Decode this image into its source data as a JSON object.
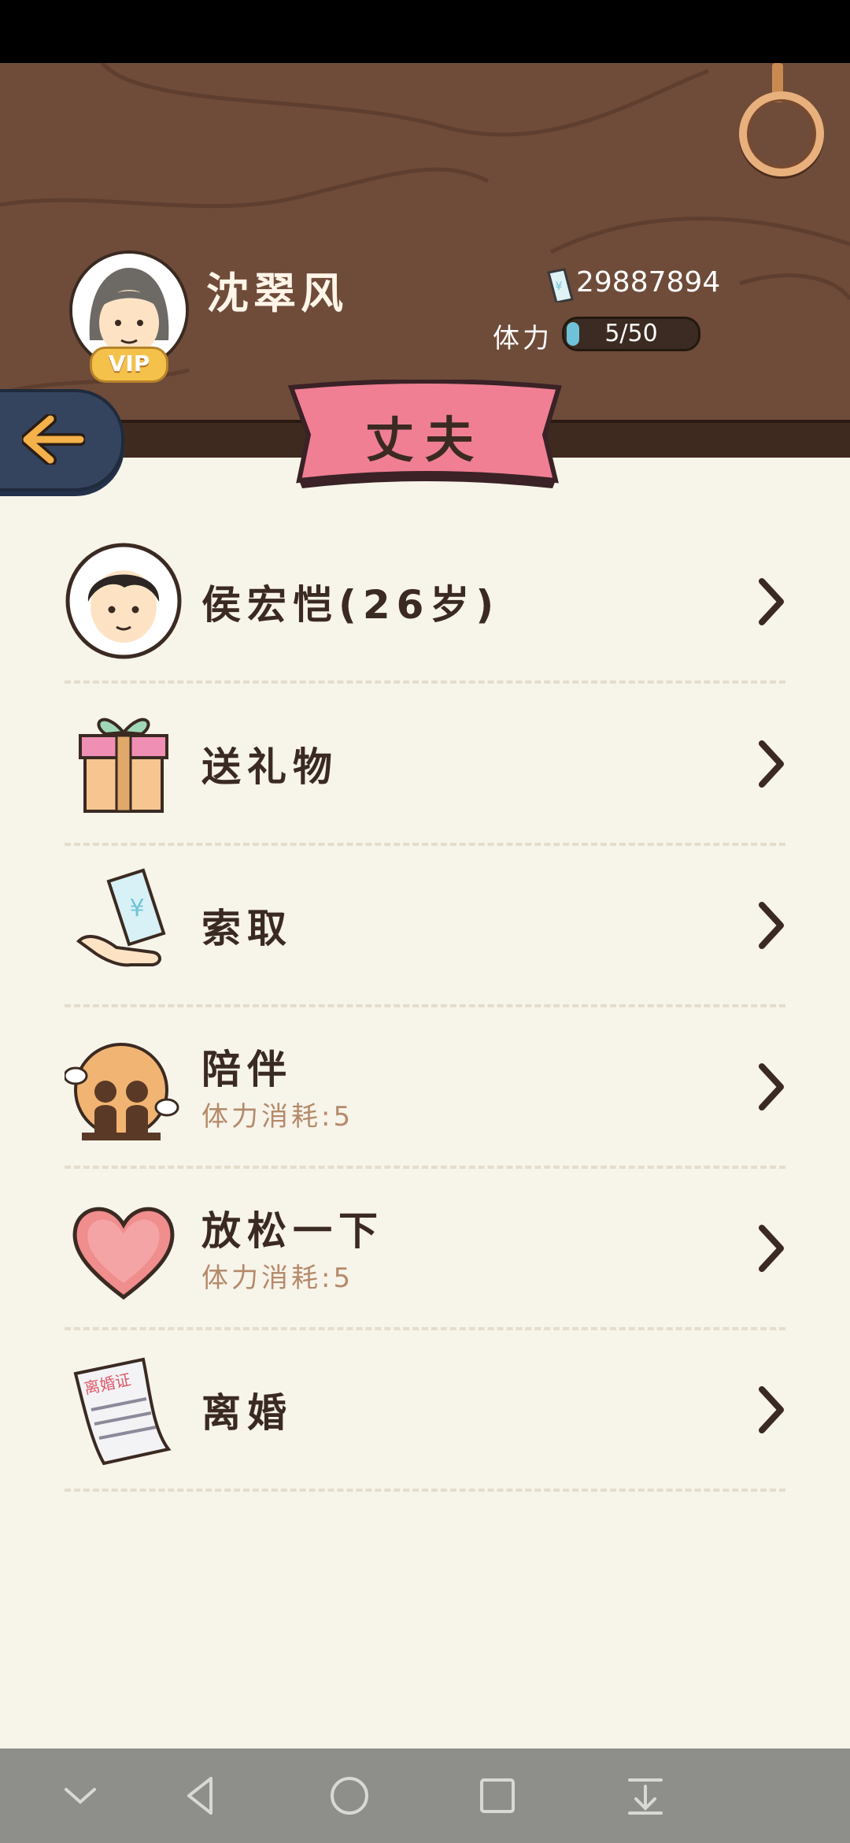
{
  "player": {
    "name": "沈翠风",
    "vip_label": "VIP",
    "money": "29887894"
  },
  "stamina": {
    "label": "体力",
    "text": "5/50",
    "current": 5,
    "max": 50
  },
  "page": {
    "title": "丈夫"
  },
  "menu": [
    {
      "title": "侯宏恺(26岁)",
      "icon": "husband-avatar-icon"
    },
    {
      "title": "送礼物",
      "icon": "gift-icon"
    },
    {
      "title": "索取",
      "icon": "money-hand-icon"
    },
    {
      "title": "陪伴",
      "subtitle": "体力消耗:5",
      "icon": "companion-icon"
    },
    {
      "title": "放松一下",
      "subtitle": "体力消耗:5",
      "icon": "heart-icon"
    },
    {
      "title": "离婚",
      "icon": "divorce-certificate-icon",
      "certificate_text": "离婚证"
    }
  ],
  "colors": {
    "header": "#6f4b39",
    "ribbon": "#f07f94",
    "background": "#f7f4ea",
    "back_button": "#34435e"
  }
}
